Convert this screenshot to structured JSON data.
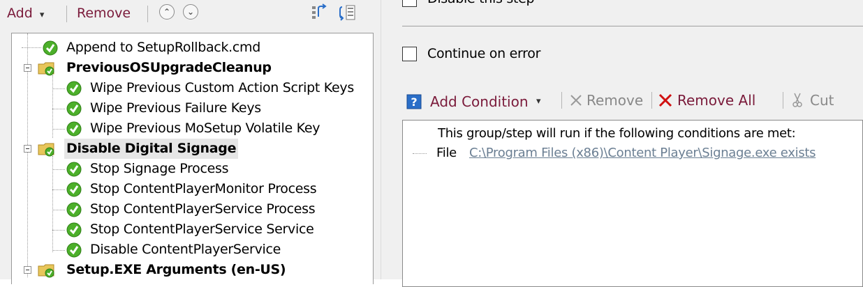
{
  "toolbar": {
    "add_label": "Add",
    "add_arrow": "▾",
    "remove_label": "Remove",
    "move_up_glyph": "⌃",
    "move_down_glyph": "⌄"
  },
  "tree": {
    "items": [
      {
        "label": "Append to SetupRollback.cmd",
        "kind": "step"
      },
      {
        "label": "PreviousOSUpgradeCleanup",
        "kind": "group"
      },
      {
        "label": "Wipe Previous Custom Action Script Keys",
        "kind": "step"
      },
      {
        "label": "Wipe Previous Failure Keys",
        "kind": "step"
      },
      {
        "label": "Wipe Previous MoSetup Volatile Key",
        "kind": "step"
      },
      {
        "label": "Disable Digital Signage",
        "kind": "group",
        "selected": true
      },
      {
        "label": "Stop Signage Process",
        "kind": "step"
      },
      {
        "label": "Stop ContentPlayerMonitor Process",
        "kind": "step"
      },
      {
        "label": "Stop ContentPlayerService Process",
        "kind": "step"
      },
      {
        "label": "Stop ContentPlayerService Service",
        "kind": "step"
      },
      {
        "label": "Disable ContentPlayerService",
        "kind": "step"
      },
      {
        "label": "Setup.EXE Arguments (en-US)",
        "kind": "group"
      }
    ]
  },
  "options": {
    "disable_step_label": "Disable this step",
    "continue_on_error_label": "Continue on error"
  },
  "conditions": {
    "toolbar": {
      "add_condition": "Add Condition",
      "add_arrow": "▾",
      "remove": "Remove",
      "remove_all": "Remove All",
      "cut": "Cut"
    },
    "header": "This group/step will run if the following conditions are met:",
    "rows": [
      {
        "type": "File",
        "condition": "C:\\Program Files (x86)\\Content Player\\Signage.exe exists"
      }
    ]
  },
  "colors": {
    "toolbar_text": "#7a1a3a",
    "check_green": "#4caf2a",
    "link_gray": "#6b7f93",
    "remove_all_red": "#d01010"
  }
}
